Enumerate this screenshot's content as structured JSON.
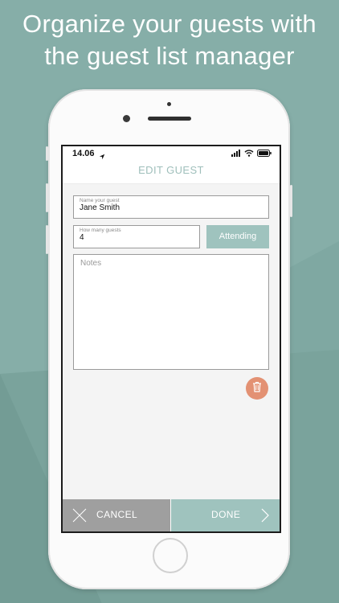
{
  "promo": {
    "headline_line1": "Organize your guests with",
    "headline_line2": "the guest list manager"
  },
  "status_bar": {
    "time": "14.06"
  },
  "nav": {
    "title": "EDIT GUEST"
  },
  "form": {
    "name_label": "Name your guest",
    "name_value": "Jane Smith",
    "count_label": "How many guests",
    "count_value": "4",
    "attending_label": "Attending",
    "notes_placeholder": "Notes"
  },
  "actions": {
    "cancel_label": "CANCEL",
    "done_label": "DONE"
  },
  "icons": {
    "location": "location-arrow-icon",
    "signal": "cell-signal-icon",
    "wifi": "wifi-icon",
    "battery": "battery-icon",
    "delete": "trash-icon",
    "cancel": "close-icon",
    "done": "chevron-right-icon"
  },
  "colors": {
    "accent": "#9fc3be",
    "delete": "#e39173",
    "cancel": "#9f9f9f",
    "background": "#7fa8a2"
  }
}
